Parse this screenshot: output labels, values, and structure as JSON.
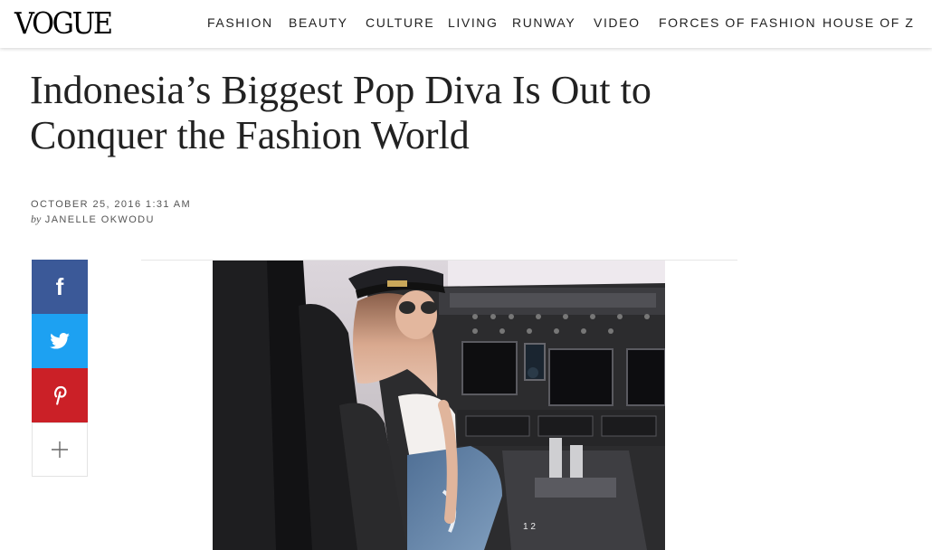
{
  "header": {
    "logo": "VOGUE",
    "nav": [
      "FASHION",
      "BEAUTY",
      "CULTURE",
      "LIVING",
      "RUNWAY",
      "VIDEO",
      "FORCES OF FASHION",
      "HOUSE OF Z"
    ]
  },
  "article": {
    "title_line1": "Indonesia’s Biggest Pop Diva Is Out to",
    "title_line2": "Conquer the Fashion World",
    "date": "OCTOBER 25, 2016 1:31 AM",
    "by_prefix": "by",
    "author": "JANELLE OKWODU"
  },
  "share": {
    "facebook_icon": "f",
    "twitter_icon": "twitter-bird-icon",
    "pinterest_icon": "pinterest-icon",
    "more_icon": "plus-icon"
  },
  "colors": {
    "facebook": "#3b5998",
    "twitter": "#1da1f2",
    "pinterest": "#cb2027"
  }
}
